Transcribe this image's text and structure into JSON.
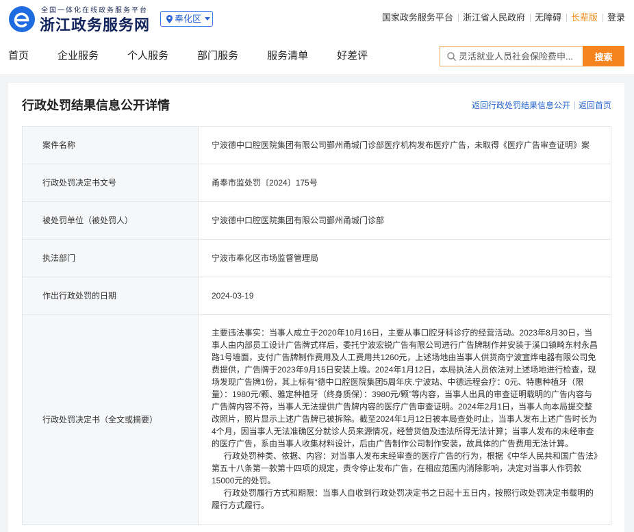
{
  "theme": {
    "brand_blue": "#1f6be0",
    "title_navy": "#14245c",
    "region_blue": "#2a63d4",
    "accent_orange": "#f5841f",
    "search_border": "#f2a75c",
    "link_blue": "#2a67cc",
    "page_background": "#f2f3f5",
    "label_background": "#f6f7f9"
  },
  "header": {
    "logo_icon": "zhejiang-egov-logo-icon",
    "platform_subtitle": "全国一体化在线政务服务平台",
    "site_title": "浙江政务服务网",
    "region_selector": {
      "icon": "location-pin-icon",
      "label": "奉化区",
      "dropdown_icon": "caret-down-icon"
    },
    "top_links": [
      {
        "label": "国家政务服务平台"
      },
      {
        "label": "浙江省人民政府"
      },
      {
        "label": "无障碍"
      },
      {
        "label": "长辈版",
        "color": "#f08c1e"
      },
      {
        "label": "登录"
      }
    ]
  },
  "nav": {
    "items": [
      "首页",
      "企业服务",
      "个人服务",
      "部门服务",
      "服务清单",
      "好差评"
    ]
  },
  "search": {
    "icon": "search-icon",
    "placeholder": "灵活就业人员社会保险费申...",
    "button_label": "搜索"
  },
  "page": {
    "title": "行政处罚结果信息公开详情",
    "links": [
      {
        "label": "返回行政处罚结果信息公开"
      },
      {
        "label": "返回首页"
      }
    ]
  },
  "detail": {
    "rows": [
      {
        "label": "案件名称",
        "value": "宁波德中口腔医院集团有限公司鄞州甬城门诊部医疗机构发布医疗广告，未取得《医疗广告审查证明》案"
      },
      {
        "label": "行政处罚决定书文号",
        "value": "甬奉市监处罚〔2024〕175号"
      },
      {
        "label": "被处罚单位（被处罚人）",
        "value": "宁波德中口腔医院集团有限公司鄞州甬城门诊部"
      },
      {
        "label": "执法部门",
        "value": "宁波市奉化区市场监督管理局"
      },
      {
        "label": "作出行政处罚的日期",
        "value": "2024-03-19"
      }
    ],
    "decision": {
      "label": "行政处罚决定书（全文或摘要）",
      "paragraphs": [
        "主要违法事实：当事人成立于2020年10月16日，主要从事口腔牙科诊疗的经营活动。2023年8月30日，当事人由内部员工设计广告牌式样后，委托宁波宏锐广告有限公司进行广告牌制作并安装于溪口镇畸东村永昌路1号墙面，支付广告牌制作费用及人工费用共1260元，上述场地由当事人供货商宁波宣烨电器有限公司免费提供，广告牌于2023年9月15日安装上墙。2024年1月12日，本局执法人员依法对上述场地进行检查，现场发现广告牌1份，其上标有“德中口腔医院集团5周年庆.宁波站、中德远程会疗：0元、特惠种植牙（限量）：1980元/颗、雅定种植牙（终身质保）：3980元/颗”等内容，当事人出具的审查证明载明的广告内容与广告牌内容不符，当事人无法提供广告牌内容的医疗广告审查证明。2024年2月1日，当事人向本局提交整改照片，照片显示上述广告牌已被拆除。截至2024年1月12日被本局查处时止，当事人发布上述广告时长为4个月，因当事人无法准确区分就诊人员来源情况，经营货值及违法所得无法计算；当事人发布的未经审查的医疗广告，系由当事人收集材料设计，后由广告制作公司制作安装，故具体的广告费用无法计算。",
        "行政处罚种类、依据、内容：对当事人发布未经审查的医疗广告的行为，根据《中华人民共和国广告法》第五十八条第一款第十四项的规定，责令停止发布广告，在相应范围内消除影响，决定对当事人作罚款15000元的处罚。",
        "行政处罚履行方式和期限：当事人自收到行政处罚决定书之日起十五日内，按照行政处罚决定书载明的履行方式履行。"
      ]
    }
  }
}
